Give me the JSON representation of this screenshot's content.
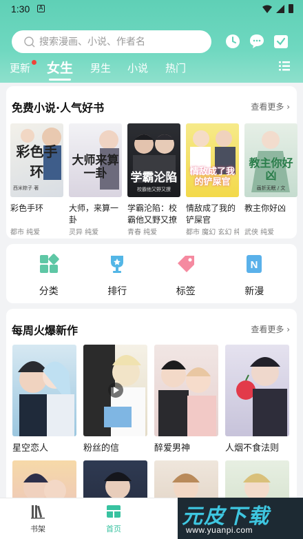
{
  "status": {
    "time": "1:30",
    "a_icon": "A"
  },
  "search": {
    "placeholder": "搜索漫画、小说、作者名"
  },
  "tabs": [
    {
      "label": "更新",
      "has_dot": true
    },
    {
      "label": "女生",
      "active": true
    },
    {
      "label": "男生"
    },
    {
      "label": "小说"
    },
    {
      "label": "热门"
    }
  ],
  "section1": {
    "title": "免费小说·人气好书",
    "more": "查看更多",
    "books": [
      {
        "name": "彩色手环",
        "tags": "都市 纯爱",
        "cover_text": "彩色手环",
        "cover_sub": "西米粽子 著"
      },
      {
        "name": "大师，来算一卦",
        "tags": "灵异 纯爱",
        "cover_text": "大师来算一卦",
        "cover_sub": ""
      },
      {
        "name": "学霸沦陷：校霸他又野又撩",
        "tags": "青春 纯爱",
        "cover_text": "学霸沦陷",
        "cover_sub": "校霸他又野又撩"
      },
      {
        "name": "情敌成了我的铲屎官",
        "tags": "都市 魔幻 玄幻 纯",
        "cover_text": "情敌成了我的铲屎官",
        "cover_sub": ""
      },
      {
        "name": "教主你好凶",
        "tags": "武侠 纯爱",
        "cover_text": "教主你好凶",
        "cover_sub": "画折无眠 / 文"
      }
    ]
  },
  "categories": [
    {
      "label": "分类",
      "icon": "grid-icon"
    },
    {
      "label": "排行",
      "icon": "trophy-icon"
    },
    {
      "label": "标签",
      "icon": "tag-icon"
    },
    {
      "label": "新漫",
      "icon": "new-icon"
    }
  ],
  "section2": {
    "title": "每周火爆新作",
    "more": "查看更多",
    "comics": [
      {
        "name": "星空恋人"
      },
      {
        "name": "粉丝的信"
      },
      {
        "name": "醉爱男神"
      },
      {
        "name": "人烟不食法则"
      },
      {
        "name": ""
      },
      {
        "name": ""
      },
      {
        "name": ""
      },
      {
        "name": ""
      }
    ]
  },
  "bottom_nav": [
    {
      "label": "书架",
      "icon": "bookshelf-icon"
    },
    {
      "label": "首页",
      "icon": "home-icon",
      "active": true
    }
  ],
  "watermark": {
    "text": "元皮下载",
    "url": "www.yuanpi.com"
  },
  "colors": {
    "accent": "#38c2a0",
    "header": "#6fd8c0",
    "dot": "#f04438"
  }
}
